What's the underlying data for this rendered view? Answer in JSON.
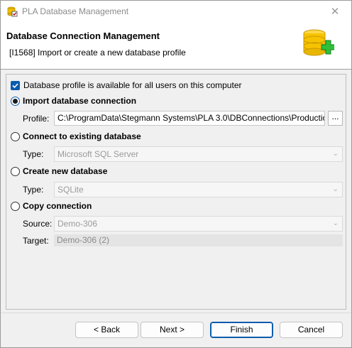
{
  "window": {
    "title": "PLA Database Management",
    "close_glyph": "✕"
  },
  "header": {
    "title": "Database Connection Management",
    "subtitle": "[I1568] Import or create a new database profile",
    "icon": "database-add-icon"
  },
  "options": {
    "all_users_label": "Database profile is available for all users on this computer",
    "all_users_checked": true,
    "import": {
      "label": "Import database connection",
      "selected": true,
      "profile_label": "Profile:",
      "profile_value": "C:\\ProgramData\\Stegmann Systems\\PLA 3.0\\DBConnections\\Productio",
      "browse_label": "..."
    },
    "connect": {
      "label": "Connect to existing database",
      "selected": false,
      "type_label": "Type:",
      "type_value": "Microsoft SQL Server"
    },
    "create": {
      "label": "Create new database",
      "selected": false,
      "type_label": "Type:",
      "type_value": "SQLite"
    },
    "copy": {
      "label": "Copy connection",
      "selected": false,
      "source_label": "Source:",
      "source_value": "Demo-306",
      "target_label": "Target:",
      "target_value": "Demo-306 (2)"
    }
  },
  "buttons": {
    "back": "< Back",
    "next": "Next >",
    "finish": "Finish",
    "cancel": "Cancel"
  },
  "colors": {
    "accent": "#0b5cad",
    "dialog_bg": "#f0f0f0"
  }
}
